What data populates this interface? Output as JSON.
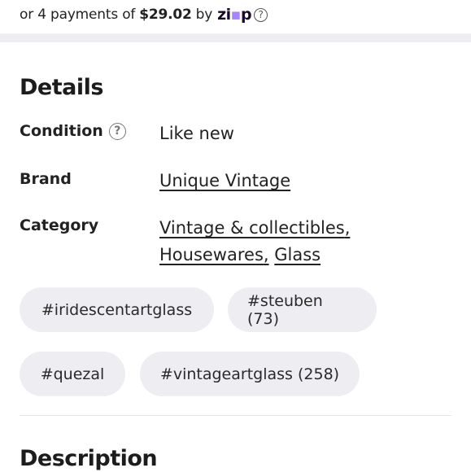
{
  "payment": {
    "prefix": "or 4 payments of",
    "amount": "$29.02",
    "by": "by",
    "provider_zi": "zi",
    "provider_p": "p",
    "help_glyph": "?"
  },
  "details": {
    "title": "Details",
    "condition": {
      "label": "Condition",
      "value": "Like new"
    },
    "brand": {
      "label": "Brand",
      "value": "Unique Vintage"
    },
    "category": {
      "label": "Category",
      "links": [
        "Vintage & collectibles",
        "Housewares",
        "Glass"
      ],
      "separator": ","
    }
  },
  "tags": [
    "#iridescentartglass",
    "#steuben (73)",
    "#quezal",
    "#vintageartglass (258)"
  ],
  "description": {
    "title": "Description"
  },
  "colors": {
    "band": "#eeeef2",
    "tag_bg": "#eeeef2",
    "zip_accent": "#a982ff"
  }
}
